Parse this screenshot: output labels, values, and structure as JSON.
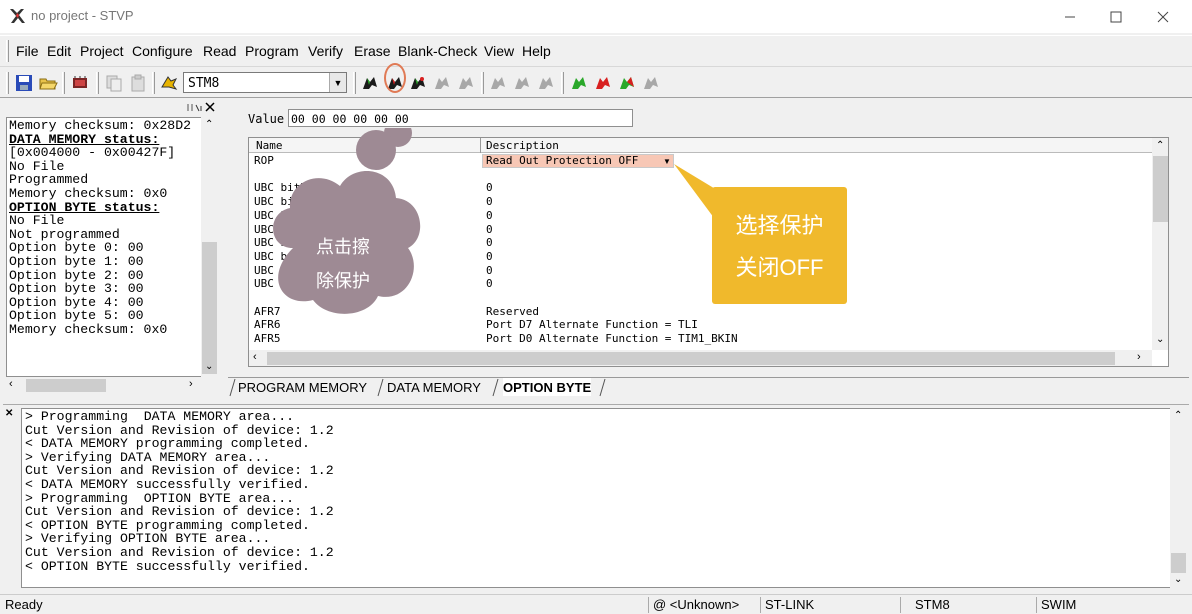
{
  "window": {
    "title": "no project - STVP",
    "icon": "stvp-app-icon",
    "controls": [
      "minimize-icon",
      "maximize-icon",
      "close-icon"
    ]
  },
  "menu": {
    "items": [
      {
        "label": "File"
      },
      {
        "label": "Edit"
      },
      {
        "label": "Project"
      },
      {
        "label": "Configure"
      },
      {
        "label": "Read"
      },
      {
        "label": "Program"
      },
      {
        "label": "Verify"
      },
      {
        "label": "Erase"
      },
      {
        "label": "Blank-Check"
      },
      {
        "label": "View"
      },
      {
        "label": "Help"
      }
    ]
  },
  "toolbar": {
    "device": "STM8",
    "icons": [
      "save-icon",
      "open-icon",
      "device-icon",
      "copy-icon",
      "paste-icon",
      "connect-icon",
      "read-icon",
      "erase-icon",
      "program-icon",
      "verify-icon",
      "blank-check-icon",
      "read-all-icon",
      "erase-all-icon",
      "program-all-icon",
      "verify-all-icon"
    ],
    "highlighted_icon": "erase-icon"
  },
  "left_panel": {
    "lines": [
      {
        "text": "Memory checksum: 0x28D2",
        "bold": false
      },
      {
        "text": "",
        "bold": false
      },
      {
        "text": "DATA MEMORY status:",
        "bold": true
      },
      {
        "text": "[0x004000 - 0x00427F]",
        "bold": false
      },
      {
        "text": "No File",
        "bold": false
      },
      {
        "text": "Programmed",
        "bold": false
      },
      {
        "text": "Memory checksum: 0x0",
        "bold": false
      },
      {
        "text": "",
        "bold": false
      },
      {
        "text": "OPTION BYTE status:",
        "bold": true
      },
      {
        "text": "No File",
        "bold": false
      },
      {
        "text": "Not programmed",
        "bold": false
      },
      {
        "text": "Option byte 0: 00",
        "bold": false
      },
      {
        "text": "Option byte 1: 00",
        "bold": false
      },
      {
        "text": "Option byte 2: 00",
        "bold": false
      },
      {
        "text": "Option byte 3: 00",
        "bold": false
      },
      {
        "text": "Option byte 4: 00",
        "bold": false
      },
      {
        "text": "Option byte 5: 00",
        "bold": false
      },
      {
        "text": "Memory checksum: 0x0",
        "bold": false
      }
    ]
  },
  "main": {
    "value_label": "Value",
    "value": "00 00 00 00 00 00",
    "columns": [
      "Name",
      "Description"
    ],
    "rows": [
      {
        "name": "ROP",
        "desc": "Read Out Protection OFF",
        "selected": true
      },
      {
        "name": "",
        "desc": ""
      },
      {
        "name": "UBC bit7",
        "desc": "0"
      },
      {
        "name": "UBC bit6",
        "desc": "0"
      },
      {
        "name": "UBC bit5",
        "desc": "0"
      },
      {
        "name": "UBC bit4",
        "desc": "0"
      },
      {
        "name": "UBC bit3",
        "desc": "0"
      },
      {
        "name": "UBC bit2",
        "desc": "0"
      },
      {
        "name": "UBC bit1",
        "desc": "0"
      },
      {
        "name": "UBC bit0",
        "desc": "0"
      },
      {
        "name": "",
        "desc": ""
      },
      {
        "name": "AFR7",
        "desc": "Reserved"
      },
      {
        "name": "AFR6",
        "desc": "Port D7 Alternate Function = TLI"
      },
      {
        "name": "AFR5",
        "desc": "Port D0 Alternate Function = TIM1_BKIN"
      }
    ],
    "tabs": [
      {
        "label": "PROGRAM MEMORY",
        "active": false
      },
      {
        "label": "DATA MEMORY",
        "active": false
      },
      {
        "label": "OPTION BYTE",
        "active": true
      }
    ]
  },
  "log": {
    "lines": [
      "> Programming  DATA MEMORY area...",
      "Cut Version and Revision of device: 1.2",
      "< DATA MEMORY programming completed.",
      "> Verifying DATA MEMORY area...",
      "Cut Version and Revision of device: 1.2",
      "< DATA MEMORY successfully verified.",
      "> Programming  OPTION BYTE area...",
      "Cut Version and Revision of device: 1.2",
      "< OPTION BYTE programming completed.",
      "> Verifying OPTION BYTE area...",
      "Cut Version and Revision of device: 1.2",
      "< OPTION BYTE successfully verified."
    ]
  },
  "status": {
    "ready": "Ready",
    "file": "@ <Unknown>",
    "tool": "ST-LINK",
    "device": "STM8",
    "protocol": "SWIM"
  },
  "annotations": {
    "bubble": {
      "line1": "点击擦",
      "line2": "除保护",
      "color": "#9e8a94"
    },
    "note": {
      "line1": "选择保护",
      "line2": "关闭OFF",
      "color": "#f0b92c"
    },
    "ring_color": "#e07a55"
  }
}
